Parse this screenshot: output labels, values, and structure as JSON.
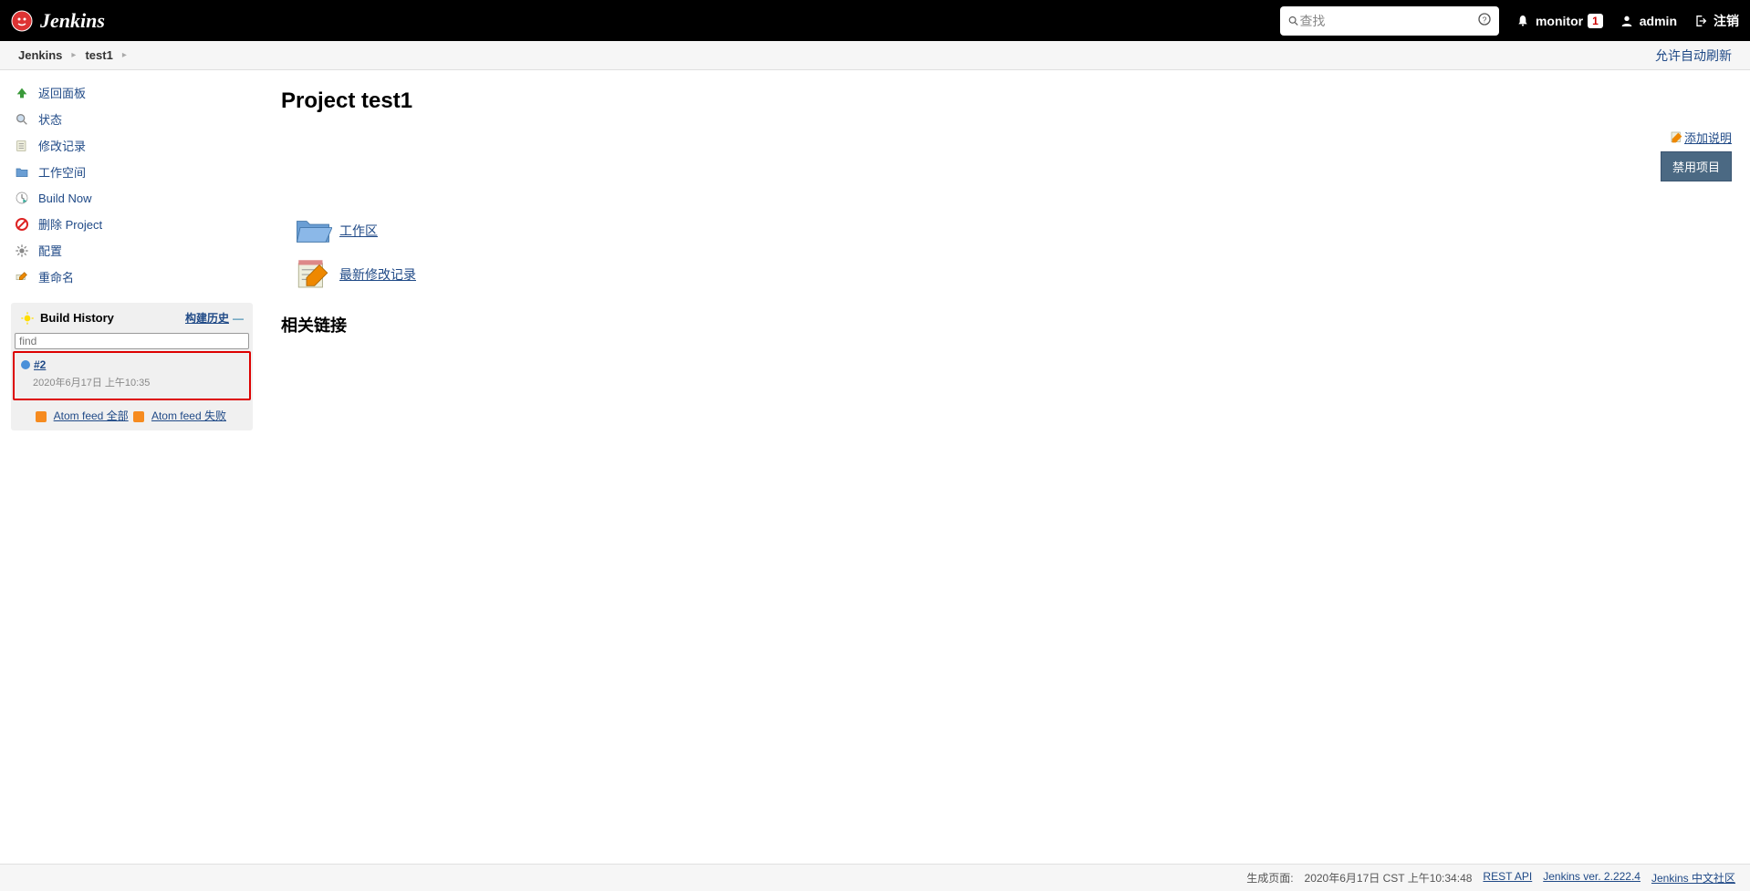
{
  "header": {
    "app_name": "Jenkins",
    "search_placeholder": "查找",
    "monitor_label": "monitor",
    "monitor_count": "1",
    "user_label": "admin",
    "logout_label": "注销"
  },
  "breadcrumbs": {
    "items": [
      "Jenkins",
      "test1"
    ],
    "auto_refresh": "允许自动刷新"
  },
  "sidebar": {
    "tasks": [
      {
        "label": "返回面板",
        "icon": "up-arrow-icon"
      },
      {
        "label": "状态",
        "icon": "magnifier-icon"
      },
      {
        "label": "修改记录",
        "icon": "notepad-icon"
      },
      {
        "label": "工作空间",
        "icon": "folder-icon"
      },
      {
        "label": "Build Now",
        "icon": "clock-play-icon"
      },
      {
        "label": "删除 Project",
        "icon": "prohibit-icon"
      },
      {
        "label": "配置",
        "icon": "gear-icon"
      },
      {
        "label": "重命名",
        "icon": "rename-icon"
      }
    ],
    "history": {
      "title": "Build History",
      "trend": "构建历史",
      "find_placeholder": "find",
      "builds": [
        {
          "num": "#2",
          "date": "2020年6月17日 上午10:35"
        }
      ],
      "feed_all": "Atom feed 全部",
      "feed_fail": "Atom feed 失败"
    }
  },
  "main": {
    "title": "Project test1",
    "add_description": "添加说明",
    "disable_button": "禁用项目",
    "workspace_link": "工作区",
    "changes_link": "最新修改记录",
    "related_links_heading": "相关链接"
  },
  "footer": {
    "gen_prefix": "生成页面:",
    "gen_time": "2020年6月17日 CST 上午10:34:48",
    "rest_api": "REST API",
    "version": "Jenkins ver. 2.222.4",
    "community": "Jenkins 中文社区"
  }
}
